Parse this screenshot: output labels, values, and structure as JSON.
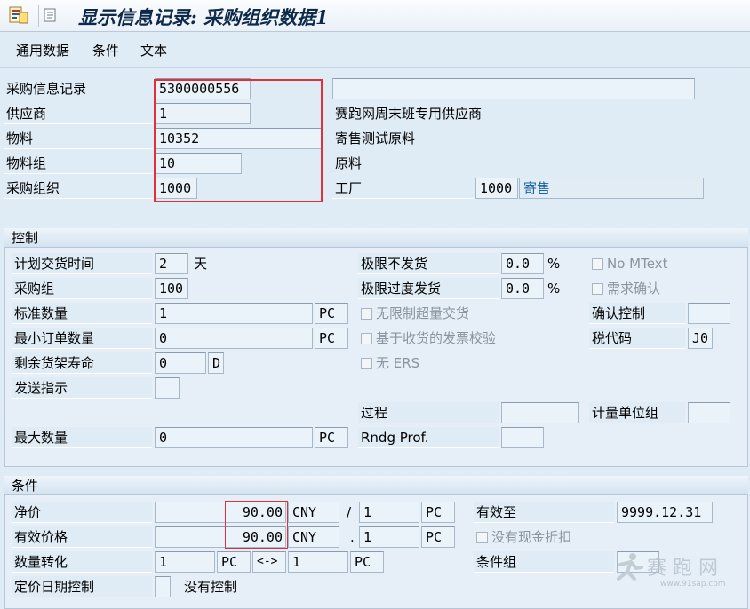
{
  "window": {
    "title": "显示信息记录: 采购组织数据1"
  },
  "menu": [
    "通用数据",
    "条件",
    "文本"
  ],
  "header": {
    "info_record_label": "采购信息记录",
    "info_record_value": "5300000556",
    "vendor_label": "供应商",
    "vendor_value": "1",
    "vendor_name": "赛跑网周末班专用供应商",
    "material_label": "物料",
    "material_value": "10352",
    "material_desc": "寄售测试原料",
    "material_group_label": "物料组",
    "material_group_value": "10",
    "material_group_desc": "原料",
    "purch_org_label": "采购组织",
    "purch_org_value": "1000",
    "plant_label": "工厂",
    "plant_value": "1000",
    "plant_desc": "寄售"
  },
  "control": {
    "title": "控制",
    "planned_delivery_label": "计划交货时间",
    "planned_delivery_value": "2",
    "planned_delivery_unit": "天",
    "purch_group_label": "采购组",
    "purch_group_value": "100",
    "standard_qty_label": "标准数量",
    "standard_qty_value": "1",
    "standard_qty_unit": "PC",
    "min_order_qty_label": "最小订单数量",
    "min_order_qty_value": "0",
    "min_order_qty_unit": "PC",
    "rem_shelf_life_label": "剩余货架寿命",
    "rem_shelf_life_value": "0",
    "rem_shelf_life_unit": "D",
    "shipping_instr_label": "发送指示",
    "underdeliv_label": "极限不发货",
    "underdeliv_value": "0.0",
    "underdeliv_unit": "%",
    "overdeliv_label": "极限过度发货",
    "overdeliv_value": "0.0",
    "overdeliv_unit": "%",
    "unlimited_label": "无限制超量交货",
    "gr_based_iv_label": "基于收货的发票校验",
    "no_ers_label": "无 ERS",
    "no_mtext_label": "No MText",
    "ack_reqd_label": "需求确认",
    "conf_control_label": "确认控制",
    "tax_code_label": "税代码",
    "tax_code_value": "J0",
    "procedure_label": "过程",
    "uom_group_label": "计量单位组",
    "max_qty_label": "最大数量",
    "max_qty_value": "0",
    "max_qty_unit": "PC",
    "rndg_label": "Rndg Prof."
  },
  "conditions": {
    "title": "条件",
    "net_price_label": "净价",
    "net_price_value": "90.00",
    "net_price_currency": "CNY",
    "net_price_sep": "/",
    "net_price_per": "1",
    "net_price_unit": "PC",
    "eff_price_label": "有效价格",
    "eff_price_value": "90.00",
    "eff_price_currency": "CNY",
    "eff_price_sep": ".",
    "eff_price_per": "1",
    "eff_price_unit": "PC",
    "valid_to_label": "有效至",
    "valid_to_value": "9999.12.31",
    "no_cash_disc_label": "没有现金折扣",
    "qty_conv_label": "数量转化",
    "qty_conv_from": "1",
    "qty_conv_from_unit": "PC",
    "qty_conv_arrow": "<->",
    "qty_conv_to": "1",
    "qty_conv_to_unit": "PC",
    "cond_group_label": "条件组",
    "pricing_date_label": "定价日期控制",
    "pricing_date_text": "没有控制"
  },
  "watermark": {
    "text": "赛 跑 网",
    "url": "www.91sap.com"
  },
  "colors": {
    "background": "#dfebf5",
    "highlight": "#e0303a",
    "plant_desc": "#1763a7"
  }
}
